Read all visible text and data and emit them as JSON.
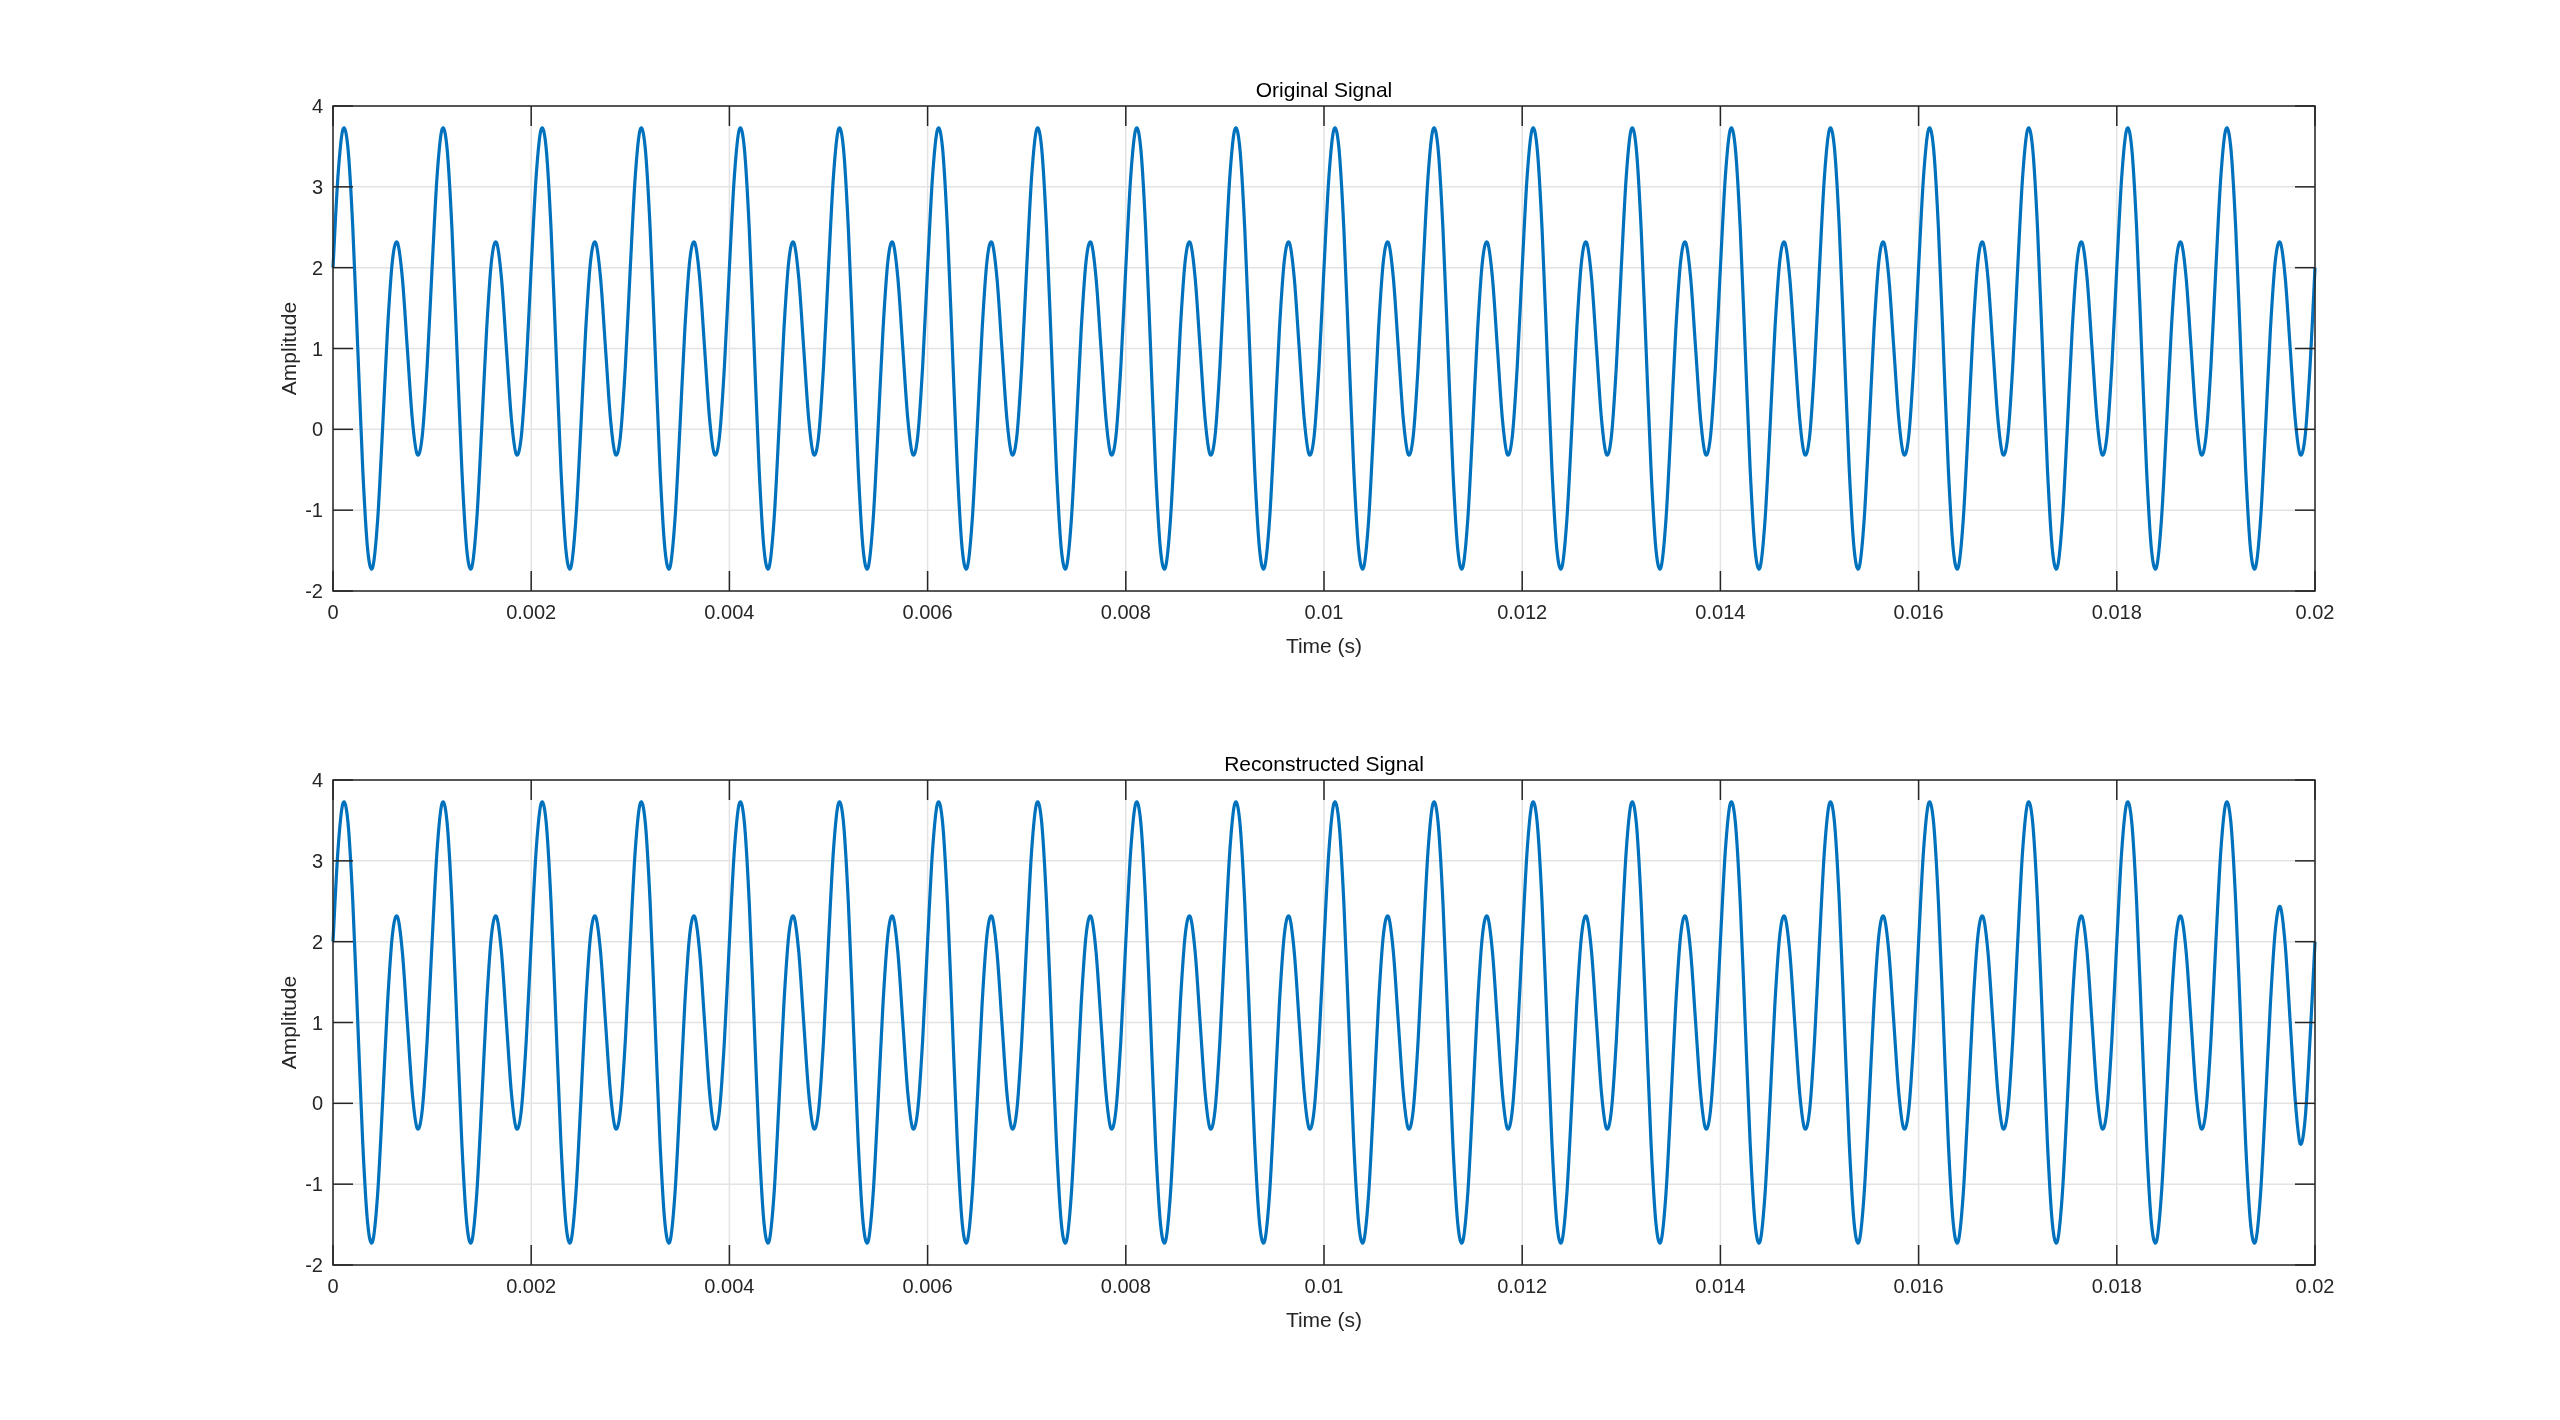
{
  "figure": {
    "plots": [
      {
        "chart_data": {
          "type": "line",
          "grid": true,
          "title": "Original Signal",
          "xlabel": "Time (s)",
          "ylabel": "Amplitude",
          "xlim": [
            0,
            0.02
          ],
          "ylim": [
            -2,
            4
          ],
          "xticks": [
            0,
            0.002,
            0.004,
            0.006,
            0.008,
            0.01,
            0.012,
            0.014,
            0.016,
            0.018,
            0.02
          ],
          "yticks": [
            -2,
            -1,
            0,
            1,
            2,
            3,
            4
          ],
          "x": [
            0,
            5e-05,
            0.0001,
            0.00015,
            0.0002,
            0.00025,
            0.0003,
            0.00035,
            0.0004,
            0.00045,
            0.0005,
            0.00055,
            0.0006,
            0.00065,
            0.0007,
            0.00075,
            0.0008,
            0.00085,
            0.0009,
            0.00095,
            0.001,
            0.00105,
            0.0011,
            0.00115,
            0.0012,
            0.00125,
            0.0013,
            0.00135,
            0.0014,
            0.00145,
            0.0015,
            0.00155,
            0.0016,
            0.00165,
            0.0017,
            0.00175,
            0.0018,
            0.00185,
            0.0019,
            0.00195,
            0.002,
            0.00205,
            0.0021,
            0.00215,
            0.0022,
            0.00225,
            0.0023,
            0.00235,
            0.0024,
            0.00245,
            0.0025,
            0.00255,
            0.0026,
            0.00265,
            0.0027,
            0.00275,
            0.0028,
            0.00285,
            0.0029,
            0.00295,
            0.003,
            0.00305,
            0.0031,
            0.00315,
            0.0032,
            0.00325,
            0.0033,
            0.00335,
            0.0034,
            0.00345,
            0.0035,
            0.00355,
            0.0036,
            0.00365,
            0.0037,
            0.00375,
            0.0038,
            0.00385,
            0.0039,
            0.00395,
            0.004,
            0.00405,
            0.0041,
            0.00415,
            0.0042,
            0.00425,
            0.0043,
            0.00435,
            0.0044,
            0.00445,
            0.0045,
            0.00455,
            0.0046,
            0.00465,
            0.0047,
            0.00475,
            0.0048,
            0.00485,
            0.0049,
            0.00495,
            0.005,
            0.00505,
            0.0051,
            0.00515,
            0.0052,
            0.00525,
            0.0053,
            0.00535,
            0.0054,
            0.00545,
            0.0055,
            0.00555,
            0.0056,
            0.00565,
            0.0057,
            0.00575,
            0.0058,
            0.00585,
            0.0059,
            0.00595,
            0.006,
            0.00605,
            0.0061,
            0.00615,
            0.0062,
            0.00625,
            0.0063,
            0.00635,
            0.0064,
            0.00645,
            0.0065,
            0.00655,
            0.0066,
            0.00665,
            0.0067,
            0.00675,
            0.0068,
            0.00685,
            0.0069,
            0.00695,
            0.007,
            0.00705,
            0.0071,
            0.00715,
            0.0072,
            0.00725,
            0.0073,
            0.00735,
            0.0074,
            0.00745,
            0.0075,
            0.00755,
            0.0076,
            0.00765,
            0.0077,
            0.00775,
            0.0078,
            0.00785,
            0.0079,
            0.00795,
            0.008,
            0.00805,
            0.0081,
            0.00815,
            0.0082,
            0.00825,
            0.0083,
            0.00835,
            0.0084,
            0.00845,
            0.0085,
            0.00855,
            0.0086,
            0.00865,
            0.0087,
            0.00875,
            0.0088,
            0.00885,
            0.0089,
            0.00895,
            0.009,
            0.00905,
            0.0091,
            0.00915,
            0.0092,
            0.00925,
            0.0093,
            0.00935,
            0.0094,
            0.00945,
            0.0095,
            0.00955,
            0.0096,
            0.00965,
            0.0097,
            0.00975,
            0.0098,
            0.00985,
            0.0099,
            0.00995,
            0.01,
            0.01005,
            0.0101,
            0.01015,
            0.0102,
            0.01025,
            0.0103,
            0.01035,
            0.0104,
            0.01045,
            0.0105,
            0.01055,
            0.0106,
            0.01065,
            0.0107,
            0.01075,
            0.0108,
            0.01085,
            0.0109,
            0.01095,
            0.011,
            0.01105,
            0.0111,
            0.01115,
            0.0112,
            0.01125,
            0.0113,
            0.01135,
            0.0114,
            0.01145,
            0.0115,
            0.01155,
            0.0116,
            0.01165,
            0.0117,
            0.01175,
            0.0118,
            0.01185,
            0.0119,
            0.01195,
            0.012,
            0.01205,
            0.0121,
            0.01215,
            0.0122,
            0.01225,
            0.0123,
            0.01235,
            0.0124,
            0.01245,
            0.0125,
            0.01255,
            0.0126,
            0.01265,
            0.0127,
            0.01275,
            0.0128,
            0.01285,
            0.0129,
            0.01295,
            0.013,
            0.01305,
            0.0131,
            0.01315,
            0.0132,
            0.01325,
            0.0133,
            0.01335,
            0.0134,
            0.01345,
            0.0135,
            0.01355,
            0.0136,
            0.01365,
            0.0137,
            0.01375,
            0.0138,
            0.01385,
            0.0139,
            0.01395,
            0.014,
            0.01405,
            0.0141,
            0.01415,
            0.0142,
            0.01425,
            0.0143,
            0.01435,
            0.0144,
            0.01445,
            0.0145,
            0.01455,
            0.0146,
            0.01465,
            0.0147,
            0.01475,
            0.0148,
            0.01485,
            0.0149,
            0.01495,
            0.015,
            0.01505,
            0.0151,
            0.01515,
            0.0152,
            0.01525,
            0.0153,
            0.01535,
            0.0154,
            0.01545,
            0.0155,
            0.01555,
            0.0156,
            0.01565,
            0.0157,
            0.01575,
            0.0158,
            0.01585,
            0.0159,
            0.01595,
            0.016,
            0.01605,
            0.0161,
            0.01615,
            0.0162,
            0.01625,
            0.0163,
            0.01635,
            0.0164,
            0.01645,
            0.0165,
            0.01655,
            0.0166,
            0.01665,
            0.0167,
            0.01675,
            0.0168,
            0.01685,
            0.0169,
            0.01695,
            0.017,
            0.01705,
            0.0171,
            0.01715,
            0.0172,
            0.01725,
            0.0173,
            0.01735,
            0.0174,
            0.01745,
            0.0175,
            0.01755,
            0.0176,
            0.01765,
            0.0177,
            0.01775,
            0.0178,
            0.01785,
            0.0179,
            0.01795,
            0.018,
            0.01805,
            0.0181,
            0.01815,
            0.0182,
            0.01825,
            0.0183,
            0.01835,
            0.0184,
            0.01845,
            0.0185,
            0.01855,
            0.0186,
            0.01865,
            0.0187,
            0.01875,
            0.0188,
            0.01885,
            0.0189,
            0.01895,
            0.019,
            0.01905,
            0.0191,
            0.01915,
            0.0192,
            0.01925,
            0.0193,
            0.01935,
            0.0194,
            0.01945,
            0.0195,
            0.01955,
            0.0196,
            0.01965,
            0.0197,
            0.01975,
            0.0198,
            0.01985,
            0.0199,
            0.01995,
            0.02
          ],
          "series": [
            {
              "color": "#0072bd",
              "values": [
                2,
                3.13,
                3.71,
                3.49,
                2.49,
                1,
                -0.49,
                -1.49,
                -1.71,
                -1.13,
                0,
                1.23,
                2.09,
                2.31,
                1.87,
                1,
                0.13,
                -0.31,
                -0.09,
                0.78,
                2,
                3.13,
                3.71,
                3.49,
                2.49,
                1,
                -0.49,
                -1.49,
                -1.71,
                -1.13,
                0,
                1.23,
                2.09,
                2.31,
                1.87,
                1,
                0.13,
                -0.31,
                -0.09,
                0.78,
                2,
                3.13,
                3.71,
                3.49,
                2.49,
                1,
                -0.49,
                -1.49,
                -1.71,
                -1.13,
                0,
                1.23,
                2.09,
                2.31,
                1.87,
                1,
                0.13,
                -0.31,
                -0.09,
                0.78,
                2,
                3.13,
                3.71,
                3.49,
                2.49,
                1,
                -0.49,
                -1.49,
                -1.71,
                -1.13,
                0,
                1.23,
                2.09,
                2.31,
                1.87,
                1,
                0.13,
                -0.31,
                -0.09,
                0.78,
                2,
                3.13,
                3.71,
                3.49,
                2.49,
                1,
                -0.49,
                -1.49,
                -1.71,
                -1.13,
                0,
                1.23,
                2.09,
                2.31,
                1.87,
                1,
                0.13,
                -0.31,
                -0.09,
                0.78,
                2,
                3.13,
                3.71,
                3.49,
                2.49,
                1,
                -0.49,
                -1.49,
                -1.71,
                -1.13,
                0,
                1.23,
                2.09,
                2.31,
                1.87,
                1,
                0.13,
                -0.31,
                -0.09,
                0.78,
                2,
                3.13,
                3.71,
                3.49,
                2.49,
                1,
                -0.49,
                -1.49,
                -1.71,
                -1.13,
                0,
                1.23,
                2.09,
                2.31,
                1.87,
                1,
                0.13,
                -0.31,
                -0.09,
                0.78,
                2,
                3.13,
                3.71,
                3.49,
                2.49,
                1,
                -0.49,
                -1.49,
                -1.71,
                -1.13,
                0,
                1.23,
                2.09,
                2.31,
                1.87,
                1,
                0.13,
                -0.31,
                -0.09,
                0.78,
                2,
                3.13,
                3.71,
                3.49,
                2.49,
                1,
                -0.49,
                -1.49,
                -1.71,
                -1.13,
                0,
                1.23,
                2.09,
                2.31,
                1.87,
                1,
                0.13,
                -0.31,
                -0.09,
                0.78,
                2,
                3.13,
                3.71,
                3.49,
                2.49,
                1,
                -0.49,
                -1.49,
                -1.71,
                -1.13,
                0,
                1.23,
                2.09,
                2.31,
                1.87,
                1,
                0.13,
                -0.31,
                -0.09,
                0.78,
                2,
                3.13,
                3.71,
                3.49,
                2.49,
                1,
                -0.49,
                -1.49,
                -1.71,
                -1.13,
                0,
                1.23,
                2.09,
                2.31,
                1.87,
                1,
                0.13,
                -0.31,
                -0.09,
                0.78,
                2,
                3.13,
                3.71,
                3.49,
                2.49,
                1,
                -0.49,
                -1.49,
                -1.71,
                -1.13,
                0,
                1.23,
                2.09,
                2.31,
                1.87,
                1,
                0.13,
                -0.31,
                -0.09,
                0.78,
                2,
                3.13,
                3.71,
                3.49,
                2.49,
                1,
                -0.49,
                -1.49,
                -1.71,
                -1.13,
                0,
                1.23,
                2.09,
                2.31,
                1.87,
                1,
                0.13,
                -0.31,
                -0.09,
                0.78,
                2,
                3.13,
                3.71,
                3.49,
                2.49,
                1,
                -0.49,
                -1.49,
                -1.71,
                -1.13,
                0,
                1.23,
                2.09,
                2.31,
                1.87,
                1,
                0.13,
                -0.31,
                -0.09,
                0.78,
                2,
                3.13,
                3.71,
                3.49,
                2.49,
                1,
                -0.49,
                -1.49,
                -1.71,
                -1.13,
                0,
                1.23,
                2.09,
                2.31,
                1.87,
                1,
                0.13,
                -0.31,
                -0.09,
                0.78,
                2,
                3.13,
                3.71,
                3.49,
                2.49,
                1,
                -0.49,
                -1.49,
                -1.71,
                -1.13,
                0,
                1.23,
                2.09,
                2.31,
                1.87,
                1,
                0.13,
                -0.31,
                -0.09,
                0.78,
                2,
                3.13,
                3.71,
                3.49,
                2.49,
                1,
                -0.49,
                -1.49,
                -1.71,
                -1.13,
                0,
                1.23,
                2.09,
                2.31,
                1.87,
                1,
                0.13,
                -0.31,
                -0.09,
                0.78,
                2,
                3.13,
                3.71,
                3.49,
                2.49,
                1,
                -0.49,
                -1.49,
                -1.71,
                -1.13,
                0,
                1.23,
                2.09,
                2.31,
                1.87,
                1,
                0.13,
                -0.31,
                -0.09,
                0.78,
                2,
                3.13,
                3.71,
                3.49,
                2.49,
                1,
                -0.49,
                -1.49,
                -1.71,
                -1.13,
                0,
                1.23,
                2.09,
                2.31,
                1.87,
                1,
                0.13,
                -0.31,
                -0.09,
                0.78,
                2,
                3.13,
                3.71,
                3.49,
                2.49,
                1,
                -0.49,
                -1.49,
                -1.71,
                -1.13,
                0,
                1.23,
                2.09,
                2.31,
                1.87,
                1,
                0.13,
                -0.31,
                -0.09,
                0.78,
                2
              ]
            }
          ]
        }
      },
      {
        "chart_data": {
          "type": "line",
          "grid": true,
          "title": "Reconstructed Signal",
          "xlabel": "Time (s)",
          "ylabel": "Amplitude",
          "xlim": [
            0,
            0.02
          ],
          "ylim": [
            -2,
            4
          ],
          "xticks": [
            0,
            0.002,
            0.004,
            0.006,
            0.008,
            0.01,
            0.012,
            0.014,
            0.016,
            0.018,
            0.02
          ],
          "yticks": [
            -2,
            -1,
            0,
            1,
            2,
            3,
            4
          ],
          "x": [
            0,
            5e-05,
            0.0001,
            0.00015,
            0.0002,
            0.00025,
            0.0003,
            0.00035,
            0.0004,
            0.00045,
            0.0005,
            0.00055,
            0.0006,
            0.00065,
            0.0007,
            0.00075,
            0.0008,
            0.00085,
            0.0009,
            0.00095,
            0.001,
            0.00105,
            0.0011,
            0.00115,
            0.0012,
            0.00125,
            0.0013,
            0.00135,
            0.0014,
            0.00145,
            0.0015,
            0.00155,
            0.0016,
            0.00165,
            0.0017,
            0.00175,
            0.0018,
            0.00185,
            0.0019,
            0.00195,
            0.002,
            0.00205,
            0.0021,
            0.00215,
            0.0022,
            0.00225,
            0.0023,
            0.00235,
            0.0024,
            0.00245,
            0.0025,
            0.00255,
            0.0026,
            0.00265,
            0.0027,
            0.00275,
            0.0028,
            0.00285,
            0.0029,
            0.00295,
            0.003,
            0.00305,
            0.0031,
            0.00315,
            0.0032,
            0.00325,
            0.0033,
            0.00335,
            0.0034,
            0.00345,
            0.0035,
            0.00355,
            0.0036,
            0.00365,
            0.0037,
            0.00375,
            0.0038,
            0.00385,
            0.0039,
            0.00395,
            0.004,
            0.00405,
            0.0041,
            0.00415,
            0.0042,
            0.00425,
            0.0043,
            0.00435,
            0.0044,
            0.00445,
            0.0045,
            0.00455,
            0.0046,
            0.00465,
            0.0047,
            0.00475,
            0.0048,
            0.00485,
            0.0049,
            0.00495,
            0.005,
            0.00505,
            0.0051,
            0.00515,
            0.0052,
            0.00525,
            0.0053,
            0.00535,
            0.0054,
            0.00545,
            0.0055,
            0.00555,
            0.0056,
            0.00565,
            0.0057,
            0.00575,
            0.0058,
            0.00585,
            0.0059,
            0.00595,
            0.006,
            0.00605,
            0.0061,
            0.00615,
            0.0062,
            0.00625,
            0.0063,
            0.00635,
            0.0064,
            0.00645,
            0.0065,
            0.00655,
            0.0066,
            0.00665,
            0.0067,
            0.00675,
            0.0068,
            0.00685,
            0.0069,
            0.00695,
            0.007,
            0.00705,
            0.0071,
            0.00715,
            0.0072,
            0.00725,
            0.0073,
            0.00735,
            0.0074,
            0.00745,
            0.0075,
            0.00755,
            0.0076,
            0.00765,
            0.0077,
            0.00775,
            0.0078,
            0.00785,
            0.0079,
            0.00795,
            0.008,
            0.00805,
            0.0081,
            0.00815,
            0.0082,
            0.00825,
            0.0083,
            0.00835,
            0.0084,
            0.00845,
            0.0085,
            0.00855,
            0.0086,
            0.00865,
            0.0087,
            0.00875,
            0.0088,
            0.00885,
            0.0089,
            0.00895,
            0.009,
            0.00905,
            0.0091,
            0.00915,
            0.0092,
            0.00925,
            0.0093,
            0.00935,
            0.0094,
            0.00945,
            0.0095,
            0.00955,
            0.0096,
            0.00965,
            0.0097,
            0.00975,
            0.0098,
            0.00985,
            0.0099,
            0.00995,
            0.01,
            0.01005,
            0.0101,
            0.01015,
            0.0102,
            0.01025,
            0.0103,
            0.01035,
            0.0104,
            0.01045,
            0.0105,
            0.01055,
            0.0106,
            0.01065,
            0.0107,
            0.01075,
            0.0108,
            0.01085,
            0.0109,
            0.01095,
            0.011,
            0.01105,
            0.0111,
            0.01115,
            0.0112,
            0.01125,
            0.0113,
            0.01135,
            0.0114,
            0.01145,
            0.0115,
            0.01155,
            0.0116,
            0.01165,
            0.0117,
            0.01175,
            0.0118,
            0.01185,
            0.0119,
            0.01195,
            0.012,
            0.01205,
            0.0121,
            0.01215,
            0.0122,
            0.01225,
            0.0123,
            0.01235,
            0.0124,
            0.01245,
            0.0125,
            0.01255,
            0.0126,
            0.01265,
            0.0127,
            0.01275,
            0.0128,
            0.01285,
            0.0129,
            0.01295,
            0.013,
            0.01305,
            0.0131,
            0.01315,
            0.0132,
            0.01325,
            0.0133,
            0.01335,
            0.0134,
            0.01345,
            0.0135,
            0.01355,
            0.0136,
            0.01365,
            0.0137,
            0.01375,
            0.0138,
            0.01385,
            0.0139,
            0.01395,
            0.014,
            0.01405,
            0.0141,
            0.01415,
            0.0142,
            0.01425,
            0.0143,
            0.01435,
            0.0144,
            0.01445,
            0.0145,
            0.01455,
            0.0146,
            0.01465,
            0.0147,
            0.01475,
            0.0148,
            0.01485,
            0.0149,
            0.01495,
            0.015,
            0.01505,
            0.0151,
            0.01515,
            0.0152,
            0.01525,
            0.0153,
            0.01535,
            0.0154,
            0.01545,
            0.0155,
            0.01555,
            0.0156,
            0.01565,
            0.0157,
            0.01575,
            0.0158,
            0.01585,
            0.0159,
            0.01595,
            0.016,
            0.01605,
            0.0161,
            0.01615,
            0.0162,
            0.01625,
            0.0163,
            0.01635,
            0.0164,
            0.01645,
            0.0165,
            0.01655,
            0.0166,
            0.01665,
            0.0167,
            0.01675,
            0.0168,
            0.01685,
            0.0169,
            0.01695,
            0.017,
            0.01705,
            0.0171,
            0.01715,
            0.0172,
            0.01725,
            0.0173,
            0.01735,
            0.0174,
            0.01745,
            0.0175,
            0.01755,
            0.0176,
            0.01765,
            0.0177,
            0.01775,
            0.0178,
            0.01785,
            0.0179,
            0.01795,
            0.018,
            0.01805,
            0.0181,
            0.01815,
            0.0182,
            0.01825,
            0.0183,
            0.01835,
            0.0184,
            0.01845,
            0.0185,
            0.01855,
            0.0186,
            0.01865,
            0.0187,
            0.01875,
            0.0188,
            0.01885,
            0.0189,
            0.01895,
            0.019,
            0.01905,
            0.0191,
            0.01915,
            0.0192,
            0.01925,
            0.0193,
            0.01935,
            0.0194,
            0.01945,
            0.0195,
            0.01955,
            0.0196,
            0.01965,
            0.0197,
            0.01975,
            0.0198,
            0.01985,
            0.0199,
            0.01995,
            0.02
          ],
          "series": [
            {
              "color": "#0072bd",
              "values": [
                2,
                3.13,
                3.71,
                3.49,
                2.49,
                1,
                -0.49,
                -1.49,
                -1.71,
                -1.13,
                0,
                1.23,
                2.09,
                2.31,
                1.87,
                1,
                0.13,
                -0.31,
                -0.09,
                0.78,
                2,
                3.13,
                3.71,
                3.49,
                2.49,
                1,
                -0.49,
                -1.49,
                -1.71,
                -1.13,
                0,
                1.23,
                2.09,
                2.31,
                1.87,
                1,
                0.13,
                -0.31,
                -0.09,
                0.78,
                2,
                3.13,
                3.71,
                3.49,
                2.49,
                1,
                -0.49,
                -1.49,
                -1.71,
                -1.13,
                0,
                1.23,
                2.09,
                2.31,
                1.87,
                1,
                0.13,
                -0.31,
                -0.09,
                0.78,
                2,
                3.13,
                3.71,
                3.49,
                2.49,
                1,
                -0.49,
                -1.49,
                -1.71,
                -1.13,
                0,
                1.23,
                2.09,
                2.31,
                1.87,
                1,
                0.13,
                -0.31,
                -0.09,
                0.78,
                2,
                3.13,
                3.71,
                3.49,
                2.49,
                1,
                -0.49,
                -1.49,
                -1.71,
                -1.13,
                0,
                1.23,
                2.09,
                2.31,
                1.87,
                1,
                0.13,
                -0.31,
                -0.09,
                0.78,
                2,
                3.13,
                3.71,
                3.49,
                2.49,
                1,
                -0.49,
                -1.49,
                -1.71,
                -1.13,
                0,
                1.23,
                2.09,
                2.31,
                1.87,
                1,
                0.13,
                -0.31,
                -0.09,
                0.78,
                2,
                3.13,
                3.71,
                3.49,
                2.49,
                1,
                -0.49,
                -1.49,
                -1.71,
                -1.13,
                0,
                1.23,
                2.09,
                2.31,
                1.87,
                1,
                0.13,
                -0.31,
                -0.09,
                0.78,
                2,
                3.13,
                3.71,
                3.49,
                2.49,
                1,
                -0.49,
                -1.49,
                -1.71,
                -1.13,
                0,
                1.23,
                2.09,
                2.31,
                1.87,
                1,
                0.13,
                -0.31,
                -0.09,
                0.78,
                2,
                3.13,
                3.71,
                3.49,
                2.49,
                1,
                -0.49,
                -1.49,
                -1.71,
                -1.13,
                0,
                1.23,
                2.09,
                2.31,
                1.87,
                1,
                0.13,
                -0.31,
                -0.09,
                0.78,
                2,
                3.13,
                3.71,
                3.49,
                2.49,
                1,
                -0.49,
                -1.49,
                -1.71,
                -1.13,
                0,
                1.23,
                2.09,
                2.31,
                1.87,
                1,
                0.13,
                -0.31,
                -0.09,
                0.78,
                2,
                3.13,
                3.71,
                3.49,
                2.49,
                1,
                -0.49,
                -1.49,
                -1.71,
                -1.13,
                0,
                1.23,
                2.09,
                2.31,
                1.87,
                1,
                0.13,
                -0.31,
                -0.09,
                0.78,
                2,
                3.13,
                3.71,
                3.49,
                2.49,
                1,
                -0.49,
                -1.49,
                -1.71,
                -1.13,
                0,
                1.23,
                2.09,
                2.31,
                1.87,
                1,
                0.13,
                -0.31,
                -0.09,
                0.78,
                2,
                3.13,
                3.71,
                3.49,
                2.49,
                1,
                -0.49,
                -1.49,
                -1.71,
                -1.13,
                0,
                1.23,
                2.09,
                2.31,
                1.87,
                1,
                0.13,
                -0.31,
                -0.09,
                0.78,
                2,
                3.13,
                3.71,
                3.49,
                2.49,
                1,
                -0.49,
                -1.49,
                -1.71,
                -1.13,
                0,
                1.23,
                2.09,
                2.31,
                1.87,
                1,
                0.13,
                -0.31,
                -0.09,
                0.78,
                2,
                3.13,
                3.71,
                3.49,
                2.49,
                1,
                -0.49,
                -1.49,
                -1.71,
                -1.13,
                0,
                1.23,
                2.09,
                2.31,
                1.87,
                1,
                0.13,
                -0.31,
                -0.09,
                0.78,
                2,
                3.13,
                3.71,
                3.49,
                2.49,
                1,
                -0.49,
                -1.49,
                -1.71,
                -1.13,
                0,
                1.23,
                2.09,
                2.31,
                1.87,
                1,
                0.13,
                -0.31,
                -0.09,
                0.78,
                2,
                3.13,
                3.71,
                3.49,
                2.49,
                1,
                -0.49,
                -1.49,
                -1.71,
                -1.13,
                0,
                1.23,
                2.09,
                2.31,
                1.87,
                1,
                0.13,
                -0.31,
                -0.09,
                0.78,
                2,
                3.13,
                3.71,
                3.49,
                2.49,
                1,
                -0.49,
                -1.49,
                -1.71,
                -1.13,
                0,
                1.23,
                2.09,
                2.31,
                1.87,
                1,
                0.13,
                -0.31,
                -0.09,
                0.78,
                2,
                3.13,
                3.71,
                3.49,
                2.49,
                1,
                -0.49,
                -1.49,
                -1.71,
                -1.13,
                0,
                1.23,
                2.09,
                2.31,
                1.87,
                1,
                0.13,
                -0.31,
                -0.09,
                0.78,
                2,
                3.13,
                3.71,
                3.49,
                2.49,
                1,
                -0.49,
                -1.49,
                -1.71,
                -1.13,
                0,
                1.23,
                2.15,
                2.43,
                1.95,
                1,
                0.05,
                -0.5,
                -0.2,
                0.8,
                2
              ]
            }
          ]
        }
      }
    ]
  }
}
